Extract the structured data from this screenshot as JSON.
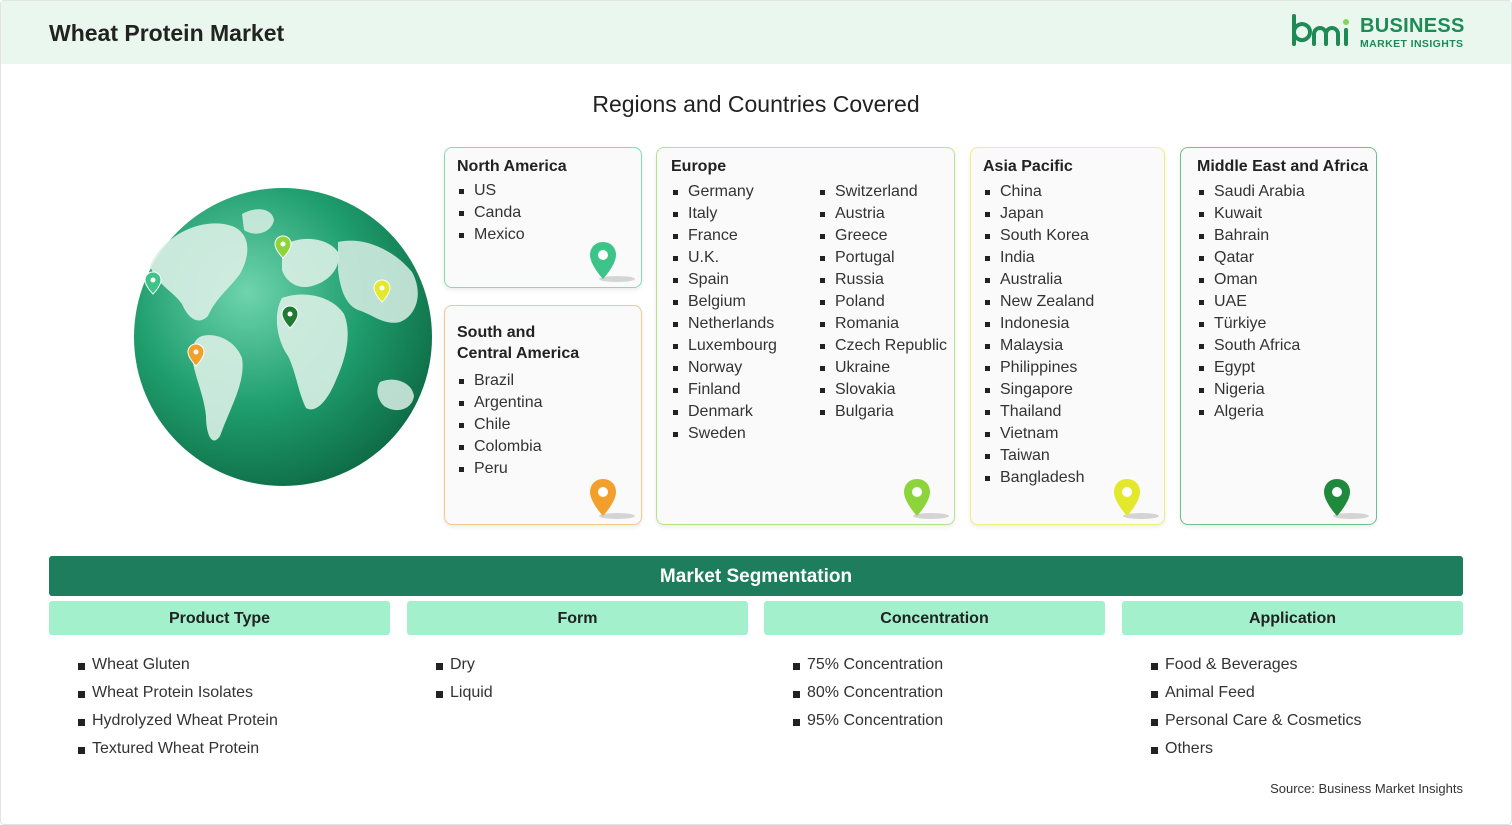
{
  "header": {
    "title": "Wheat Protein Market"
  },
  "logo": {
    "line1": "BUSINESS",
    "line2": "MARKET INSIGHTS",
    "mark": "bmi"
  },
  "regions": {
    "title": "Regions and Countries Covered",
    "north_america": {
      "title": "North America",
      "items": [
        "US",
        "Canda",
        "Mexico"
      ],
      "pin_color": "#3cc489"
    },
    "south_central_america": {
      "title_line1": "South and",
      "title_line2": "Central America",
      "items": [
        "Brazil",
        "Argentina",
        "Chile",
        "Colombia",
        "Peru"
      ],
      "pin_color": "#f2a02b"
    },
    "europe": {
      "title": "Europe",
      "col1": [
        "Germany",
        "Italy",
        "France",
        "U.K.",
        "Spain",
        "Belgium",
        "Netherlands",
        "Luxembourg",
        "Norway",
        "Finland",
        "Denmark",
        "Sweden"
      ],
      "col2": [
        "Switzerland",
        "Austria",
        "Greece",
        "Portugal",
        "Russia",
        "Poland",
        "Romania",
        "Czech Republic",
        "Ukraine",
        "Slovakia",
        "Bulgaria"
      ],
      "pin_color": "#8cd43a"
    },
    "asia_pacific": {
      "title": "Asia Pacific",
      "items": [
        "China",
        "Japan",
        "South Korea",
        "India",
        "Australia",
        "New Zealand",
        "Indonesia",
        "Malaysia",
        "Philippines",
        "Singapore",
        "Thailand",
        "Vietnam",
        "Taiwan",
        "Bangladesh"
      ],
      "pin_color": "#e4e82a"
    },
    "middle_east_africa": {
      "title": "Middle East and Africa",
      "items": [
        "Saudi Arabia",
        "Kuwait",
        "Bahrain",
        "Qatar",
        "Oman",
        "UAE",
        "Türkiye",
        "South Africa",
        "Egypt",
        "Nigeria",
        "Algeria"
      ],
      "pin_color": "#1f8a3c"
    }
  },
  "segmentation": {
    "title": "Market Segmentation",
    "columns": [
      {
        "header": "Product Type",
        "items": [
          "Wheat Gluten",
          "Wheat Protein Isolates",
          "Hydrolyzed Wheat Protein",
          "Textured Wheat Protein"
        ]
      },
      {
        "header": "Form",
        "items": [
          "Dry",
          "Liquid"
        ]
      },
      {
        "header": "Concentration",
        "items": [
          "75% Concentration",
          "80% Concentration",
          "95% Concentration"
        ]
      },
      {
        "header": "Application",
        "items": [
          "Food & Beverages",
          "Animal Feed",
          "Personal Care & Cosmetics",
          "Others"
        ]
      }
    ]
  },
  "source": "Source: Business Market Insights",
  "colors": {
    "header_bg": "#eaf7ef",
    "brand_green": "#1e8a56",
    "segment_bar": "#1e7d5d",
    "segment_head": "#a2f0cc"
  }
}
